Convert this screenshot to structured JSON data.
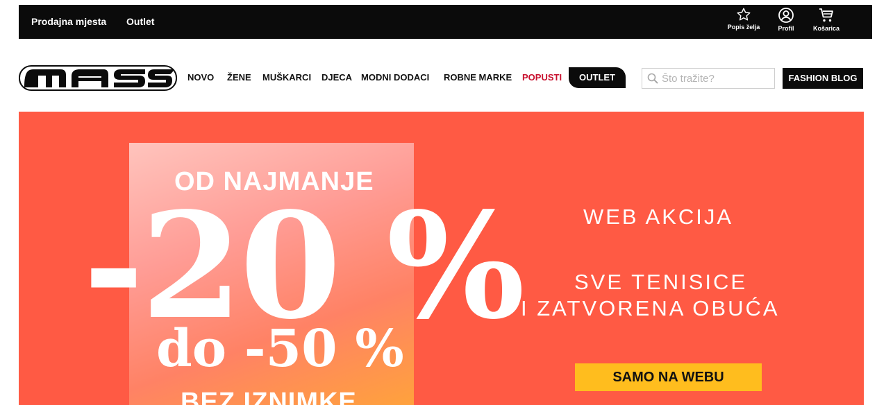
{
  "topbar": {
    "links": [
      "Prodajna mjesta",
      "Outlet"
    ],
    "icons": [
      {
        "name": "star-icon",
        "label": "Popis želja"
      },
      {
        "name": "user-icon",
        "label": "Profil"
      },
      {
        "name": "cart-icon",
        "label": "Košarica"
      }
    ]
  },
  "header": {
    "logo_text": "MASS",
    "nav": [
      "NOVO",
      "ŽENE",
      "MUŠKARCI",
      "DJECA",
      "MODNI DODACI",
      "ROBNE MARKE",
      "POPUSTI"
    ],
    "outlet_label": "OUTLET",
    "search_placeholder": "Što tražite?",
    "blog_label": "FASHION BLOG"
  },
  "banner": {
    "line1": "OD NAJMANJE",
    "big": "-20 %",
    "range": "do -50 %",
    "line4": "BEZ IZNIMKE",
    "heading": "WEB AKCIJA",
    "sub1": "SVE TENISICE",
    "sub2": "I ZATVORENA OBUĆA",
    "cta": "SAMO NA WEBU"
  },
  "colors": {
    "banner_bg": "#ff5a44",
    "cta_bg": "#ffbd1e",
    "sale_red": "#c8102e",
    "dark": "#0b0b0b"
  }
}
